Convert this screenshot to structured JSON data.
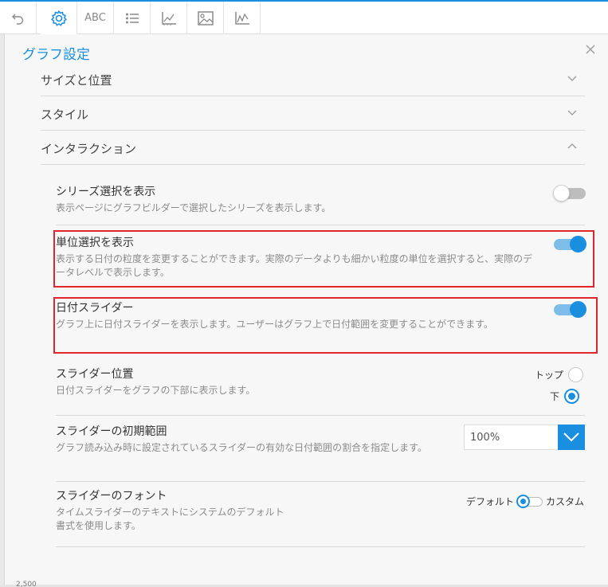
{
  "toolbar": {
    "icons": [
      "undo-icon",
      "gear-icon",
      "abc-text-icon",
      "list-icon",
      "axis-chart-icon",
      "image-icon",
      "line-chart-icon"
    ],
    "abc_label": "ABC"
  },
  "panel": {
    "title": "グラフ設定"
  },
  "sections": [
    {
      "label": "サイズと位置",
      "state": "collapsed"
    },
    {
      "label": "スタイル",
      "state": "collapsed"
    },
    {
      "label": "インタラクション",
      "state": "expanded"
    }
  ],
  "settings": {
    "series_select": {
      "name": "シリーズ選択を表示",
      "desc": "表示ページにグラフビルダーで選択したシリーズを表示します。",
      "enabled": false
    },
    "unit_select": {
      "name": "単位選択を表示",
      "desc": "表示する日付の粒度を変更することができます。実際のデータよりも細かい粒度の単位を選択すると、実際のデータレベルで表示します。",
      "enabled": true
    },
    "date_slider": {
      "name": "日付スライダー",
      "desc": "グラフ上に日付スライダーを表示します。ユーザーはグラフ上で日付範囲を変更することができます。",
      "enabled": true
    },
    "slider_position": {
      "name": "スライダー位置",
      "desc": "日付スライダーをグラフの下部に表示します。",
      "options": [
        "トップ",
        "下"
      ],
      "selected": "下"
    },
    "slider_initial_range": {
      "name": "スライダーの初期範囲",
      "desc": "グラフ読み込み時に設定されているスライダーの有効な日付範囲の割合を指定します。",
      "value": "100%"
    },
    "slider_font": {
      "name": "スライダーのフォント",
      "desc": "タイムスライダーのテキストにシステムのデフォルト書式を使用します。",
      "option_left": "デフォルト",
      "option_right": "カスタム",
      "selected": "デフォルト"
    }
  },
  "footer": {
    "axis_tick": "2,500"
  },
  "colors": {
    "accent": "#1a8fe0",
    "highlight": "#e2242d"
  }
}
